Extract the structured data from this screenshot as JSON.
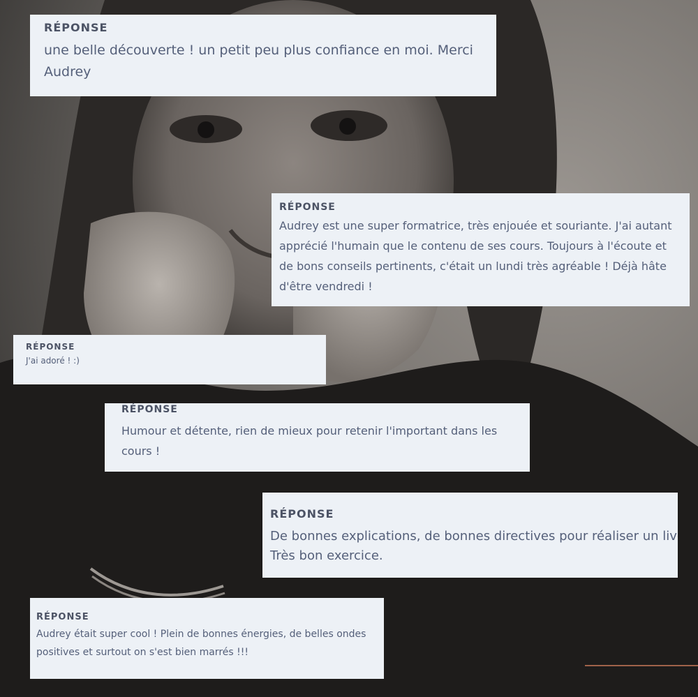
{
  "testimonials": [
    {
      "label": "RÉPONSE",
      "text": "une belle découverte ! un petit peu plus confiance en moi. Merci Audrey"
    },
    {
      "label": "RÉPONSE",
      "text": "Audrey est une super formatrice, très enjouée et souriante. J'ai autant apprécié l'humain que le contenu de ses cours. Toujours à l'écoute et de bons conseils pertinents, c'était un lundi très agréable ! Déjà hâte d'être vendredi !"
    },
    {
      "label": "RÉPONSE",
      "text": "J'ai adoré ! :)"
    },
    {
      "label": "RÉPONSE",
      "text": "Humour et détente, rien de mieux pour retenir l'important dans les cours !"
    },
    {
      "label": "RÉPONSE",
      "text": "De bonnes explications, de bonnes directives pour réaliser un live. Très bon exercice."
    },
    {
      "label": "RÉPONSE",
      "text": "Audrey était super cool ! Plein de bonnes énergies, de belles ondes positives et surtout on s'est bien marrés !!!"
    }
  ],
  "colors": {
    "card_background": "#edf1f6",
    "card_text": "#55607a",
    "label_text": "#4c5365",
    "accent_line": "#a0624a"
  }
}
